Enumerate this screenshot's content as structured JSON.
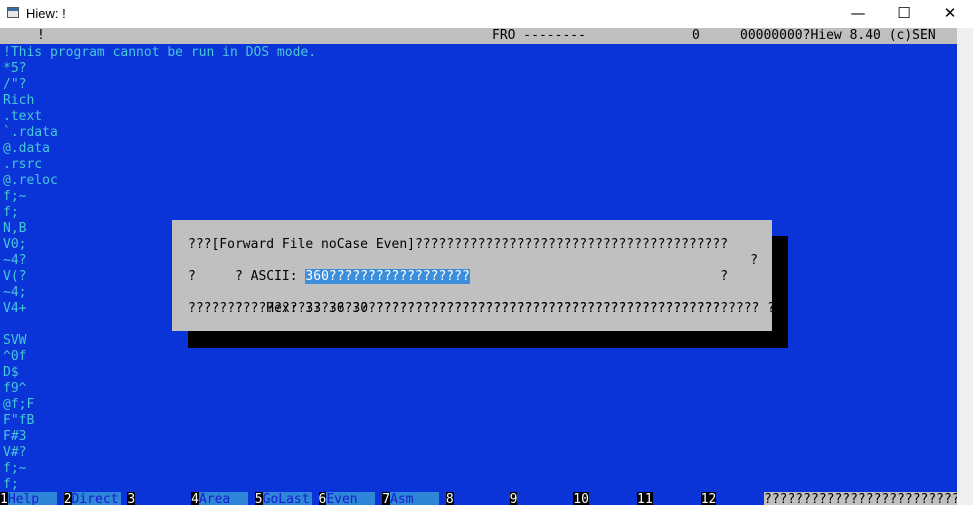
{
  "window": {
    "title": "Hiew: !",
    "minimize": "—",
    "maximize": "☐",
    "close": "✕"
  },
  "status": {
    "filename": "!",
    "mode": "FRO --------",
    "offset_value": "0",
    "address": "00000000?Hiew 8.40 (c)SEN"
  },
  "text_lines": [
    "!This program cannot be run in DOS mode.",
    "*5?",
    "/\"?",
    "Rich",
    ".text",
    "`.rdata",
    "@.data",
    ".rsrc",
    "@.reloc",
    "f;~",
    "f;",
    "N,B",
    "V0;",
    "~4?",
    "V(?",
    "~4;",
    "V4+",
    "",
    "SVW",
    "^0f",
    "D$",
    "f9^",
    "@f;F",
    "F\"fB",
    "F#3",
    "V#?",
    "f;~",
    "f;"
  ],
  "dialog": {
    "row1": "???[Forward File noCase Even]????????????????????????????????????????",
    "ascii_label": "? ASCII: ",
    "ascii_value": "360??????????????????",
    "row2_end": "?",
    "row3": "?                                                                   ?",
    "hex_label": "?   Hex: ",
    "hex_value": "33 36 30 ????????????????????????????????????????????????? ?",
    "row5": "????????????????????????????????????????????????????????????????????"
  },
  "function_keys": [
    {
      "num": "1",
      "label": "Help"
    },
    {
      "num": "2",
      "label": "Direct"
    },
    {
      "num": "3",
      "label": ""
    },
    {
      "num": "4",
      "label": "Area"
    },
    {
      "num": "5",
      "label": "GoLast"
    },
    {
      "num": "6",
      "label": "Even"
    },
    {
      "num": "7",
      "label": "Asm"
    },
    {
      "num": "8",
      "label": ""
    },
    {
      "num": "9",
      "label": ""
    },
    {
      "num": "10",
      "label": ""
    },
    {
      "num": "11",
      "label": ""
    },
    {
      "num": "12",
      "label": ""
    }
  ],
  "keybar_tail": "?????????????????????????",
  "colors": {
    "console_bg": "#0a34d8",
    "text_cyan": "#46c8d8",
    "dialog_bg": "#c0c0c0",
    "selection": "#3a8edb"
  }
}
